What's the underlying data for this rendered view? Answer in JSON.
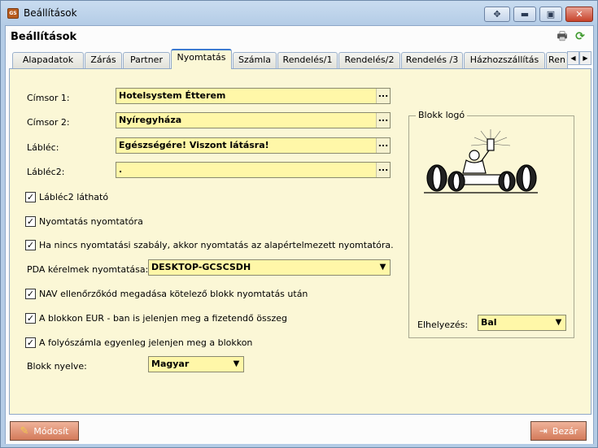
{
  "window": {
    "title": "Beállítások",
    "app_icon_text": "GS"
  },
  "header": {
    "title": "Beállítások",
    "icons": [
      "printer-icon",
      "refresh-icon"
    ]
  },
  "tabs": [
    "Alapadatok",
    "Zárás",
    "Partner",
    "Nyomtatás",
    "Számla",
    "Rendelés/1",
    "Rendelés/2",
    "Rendelés /3",
    "Házhozszállítás",
    "Ren"
  ],
  "active_tab": "Nyomtatás",
  "form": {
    "cimsor1_label": "Címsor 1:",
    "cimsor1_value": "Hotelsystem Étterem",
    "cimsor2_label": "Címsor 2:",
    "cimsor2_value": "Nyíregyháza",
    "lablec_label": "Lábléc:",
    "lablec_value": "Egészségére! Viszont látásra!",
    "lablec2_label": "Lábléc2:",
    "lablec2_value": ".",
    "lookup_button": "...",
    "chk_lablec2_visible": "Lábléc2 látható",
    "chk_print_to_printer": "Nyomtatás nyomtatóra",
    "chk_default_printer": "Ha nincs nyomtatási szabály, akkor nyomtatás az alapértelmezett nyomtatóra.",
    "pda_label": "PDA kérelmek nyomtatása:",
    "pda_value": "DESKTOP-GCSCSDH",
    "chk_nav": "NAV ellenőrzőkód megadása kötelező blokk nyomtatás után",
    "chk_eur": "A blokkon EUR - ban is jelenjen meg a fizetendő összeg",
    "chk_balance": "A folyószámla egyenleg jelenjen meg a blokkon",
    "lang_label": "Blokk nyelve:",
    "lang_value": "Magyar",
    "checked": [
      true,
      true,
      true,
      true,
      true,
      true
    ]
  },
  "logo_group": {
    "title": "Blokk logó",
    "placement_label": "Elhelyezés:",
    "placement_value": "Bal"
  },
  "footer": {
    "modify_label": "Módosít",
    "close_label": "Bezár"
  },
  "colors": {
    "panel": "#fbf7d6",
    "field": "#fff7a8",
    "button": "#d37a5a",
    "active_tab_accent": "#3d7ad0"
  }
}
